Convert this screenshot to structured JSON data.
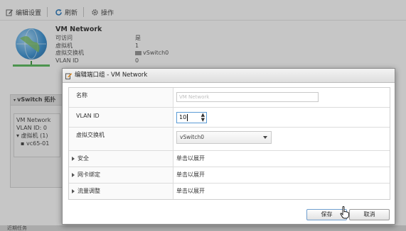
{
  "toolbar": {
    "edit_label": "编辑设置",
    "refresh_label": "刷新",
    "actions_label": "操作"
  },
  "network": {
    "name": "VM Network",
    "rows": [
      {
        "key": "可访问",
        "value": "是"
      },
      {
        "key": "虚拟机",
        "value": "1"
      },
      {
        "key": "虚拟交换机",
        "value": "vSwitch0"
      },
      {
        "key": "VLAN ID",
        "value": "0"
      }
    ]
  },
  "topology": {
    "header": "vSwitch 拓扑",
    "portgroup": "VM Network",
    "vlan": "VLAN ID: 0",
    "vms": "虚拟机 (1)",
    "vm_item": "vc65-01"
  },
  "bottom_bar": {
    "label": "近期任务"
  },
  "dialog": {
    "title": "编辑端口组 - VM Network",
    "fields": {
      "name_label": "名称",
      "name_value": "VM Network",
      "vlan_label": "VLAN ID",
      "vlan_value": "10",
      "switch_label": "虚拟交换机",
      "switch_value": "vSwitch0"
    },
    "sections": [
      {
        "label": "安全",
        "value": "单击以展开"
      },
      {
        "label": "网卡绑定",
        "value": "单击以展开"
      },
      {
        "label": "流量调整",
        "value": "单击以展开"
      }
    ],
    "save_label": "保存",
    "cancel_label": "取消"
  },
  "colors": {
    "accent": "#5b9bd5",
    "dialog_bg": "#ffffff",
    "overlay": "#505050"
  },
  "icons": [
    "edit-icon",
    "refresh-icon",
    "gear-icon",
    "globe-network-icon",
    "dialog-edit-icon",
    "spinner-icon",
    "dropdown-arrow-icon",
    "hand-cursor-icon"
  ]
}
